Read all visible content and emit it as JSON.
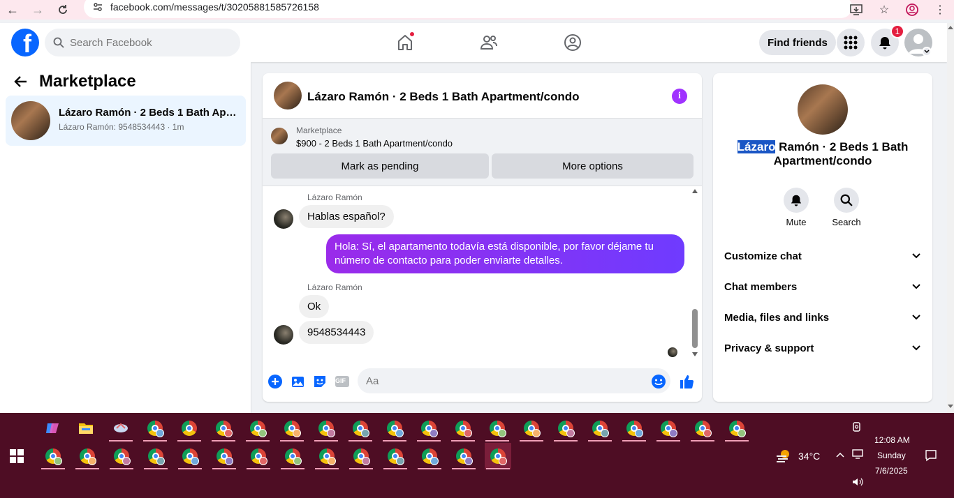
{
  "browser": {
    "url": "facebook.com/messages/t/30205881585726158"
  },
  "fb_nav": {
    "search_placeholder": "Search Facebook",
    "find_friends": "Find friends",
    "notification_count": "1"
  },
  "left": {
    "title": "Marketplace",
    "conversation": {
      "title": "Lázaro Ramón · 2 Beds 1 Bath Apartment/condo",
      "subtitle": "Lázaro Ramón: 9548534443 · 1m"
    }
  },
  "chat": {
    "header_title": "Lázaro Ramón · 2 Beds 1 Bath Apartment/condo",
    "listing": {
      "source": "Marketplace",
      "price_title": "$900 - 2 Beds 1 Bath Apartment/condo",
      "btn_pending": "Mark as pending",
      "btn_more": "More options"
    },
    "messages": [
      {
        "sender": "Lázaro Ramón",
        "text": "Hablas español?"
      },
      {
        "text": "Hola: Sí, el apartamento todavía está disponible, por favor déjame tu número de contacto para poder enviarte detalles."
      },
      {
        "sender": "Lázaro Ramón",
        "text": "Ok"
      },
      {
        "text": "9548534443"
      }
    ],
    "composer_placeholder": "Aa",
    "gif_label": "GIF"
  },
  "info_panel": {
    "name_highlight": "Lázaro",
    "name_rest": " Ramón · 2 Beds 1 Bath Apartment/condo",
    "mute": "Mute",
    "search": "Search",
    "rows": [
      "Customize chat",
      "Chat members",
      "Media, files and links",
      "Privacy & support"
    ]
  },
  "taskbar": {
    "weather": "34°C",
    "time": "12:08 AM",
    "day": "Sunday",
    "date": "7/6/2025"
  },
  "colors": {
    "fb_blue": "#0866ff",
    "messenger_purple": "#a033ff",
    "taskbar": "#4e0d24"
  }
}
